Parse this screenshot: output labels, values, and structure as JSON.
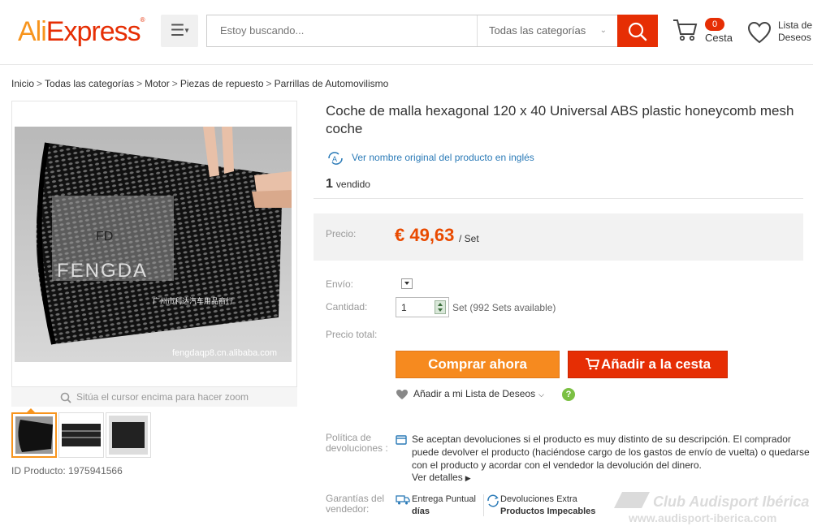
{
  "header": {
    "logo_part1": "Ali",
    "logo_part2": "Express",
    "logo_reg": "®",
    "search_placeholder": "Estoy buscando...",
    "category_select": "Todas las categorías",
    "cart_count": "0",
    "cart_label": "Cesta",
    "wishlist_label_line1": "Lista de",
    "wishlist_label_line2": "Deseos",
    "accent_color": "#e62e04"
  },
  "breadcrumb": {
    "items": [
      "Inicio",
      "Todas las categorías",
      "Motor",
      "Piezas de repuesto",
      "Parrillas de Automovilismo"
    ],
    "separator": ">"
  },
  "gallery": {
    "zoom_hint": "Sitúa el cursor encima para hacer zoom",
    "image_logo_initials": "FD",
    "image_logo_text": "FENGDA",
    "image_chinese_text": "广州市利达汽车用品商行",
    "image_url_text": "fengdaqp8.cn.alibaba.com",
    "product_id": "ID Producto: 1975941566"
  },
  "product": {
    "title": "Coche de malla hexagonal 120 x 40 Universal ABS plastic honeycomb mesh coche",
    "translate_link": "Ver nombre original del producto en inglés",
    "sold_count": "1",
    "sold_label": "vendido",
    "price_label": "Precio:",
    "price_value": "€ 49,63",
    "price_unit": "/ Set",
    "shipping_label": "Envío:",
    "quantity_label": "Cantidad:",
    "quantity_value": "1",
    "quantity_available": "Set (992 Sets available)",
    "total_label": "Precio total:",
    "buy_now_label": "Comprar ahora",
    "add_to_cart_label": "Añadir a la cesta",
    "wishlist_add_label": "Añadir a mi Lista de Deseos",
    "help_icon_text": "?"
  },
  "policy": {
    "label": "Política de devoluciones :",
    "text": "Se aceptan devoluciones si el producto es muy distinto de su descripción. El comprador puede devolver el producto (haciéndose cargo de los gastos de envío de vuelta) o quedarse con el producto y acordar con el vendedor la devolución del dinero.",
    "more_label": "Ver detalles"
  },
  "guarantees": {
    "label": "Garantías del vendedor:",
    "items": [
      {
        "line1": "Entrega Puntual",
        "line2": "días"
      },
      {
        "line1": "Devoluciones Extra",
        "line2": "Productos Impecables"
      }
    ]
  },
  "watermark": {
    "line1": "Club Audisport Ibérica",
    "line2": "www.audisport-iberica.com"
  }
}
